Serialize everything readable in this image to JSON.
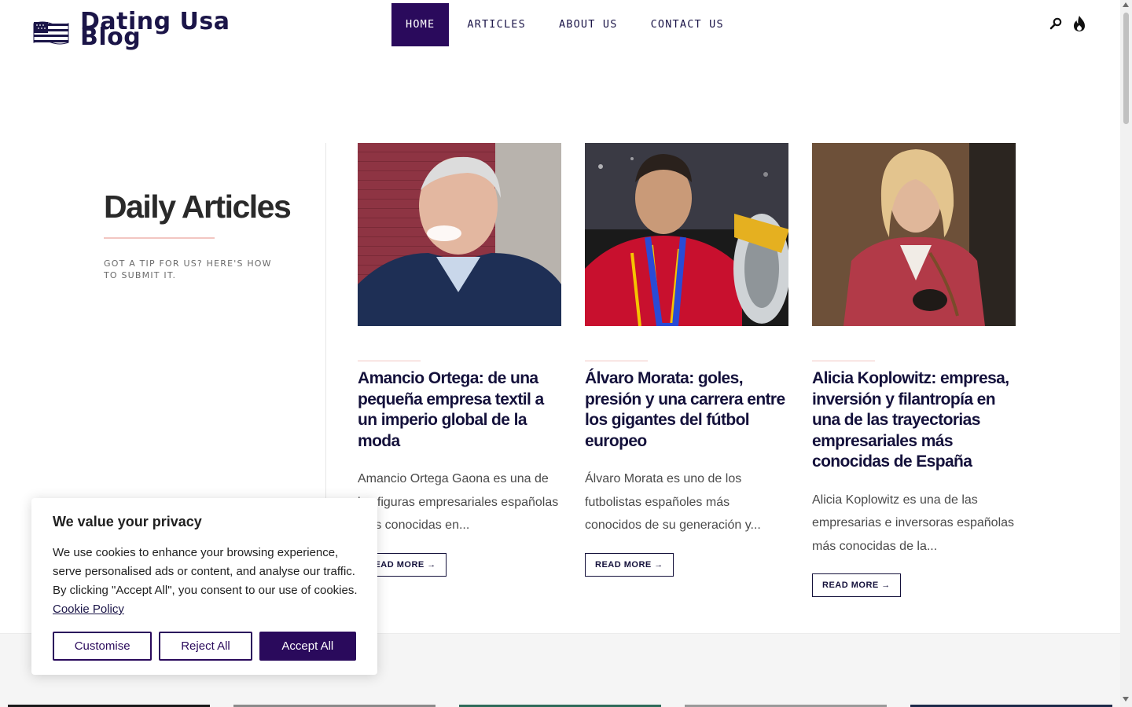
{
  "brand": {
    "name_line1": "Dating Usa",
    "name_line2": "Blog"
  },
  "nav": [
    {
      "label": "HOME",
      "active": true
    },
    {
      "label": "ARTICLES",
      "active": false
    },
    {
      "label": "ABOUT US",
      "active": false
    },
    {
      "label": "CONTACT US",
      "active": false
    }
  ],
  "header_icons": [
    "search-icon",
    "flame-icon"
  ],
  "intro": {
    "title": "Daily Articles",
    "subtitle": "GOT A TIP FOR US? HERE'S HOW TO SUBMIT IT."
  },
  "articles": [
    {
      "title": "Amancio Ortega: de una pequeña empresa textil a un imperio global de la moda",
      "excerpt": "Amancio Ortega Gaona es una de las figuras empresariales españolas más conocidas en...",
      "cta": "READ MORE →"
    },
    {
      "title": "Álvaro Morata: goles, presión y una carrera entre los gigantes del fútbol europeo",
      "excerpt": "Álvaro Morata es uno de los futbolistas españoles más conocidos de su generación y...",
      "cta": "READ MORE →"
    },
    {
      "title": "Alicia Koplowitz: empresa, inversión y filantropía en una de las trayectorias empresariales más conocidas de España",
      "excerpt": "Alicia Koplowitz es una de las empresarias e inversoras españolas más conocidas de la...",
      "cta": "READ MORE →"
    }
  ],
  "cookie": {
    "title": "We value your privacy",
    "text": "We use cookies to enhance your browsing experience, serve personalised ads or content, and analyse our traffic. By clicking \"Accept All\", you consent to our use of cookies.",
    "link": "Cookie Policy",
    "customise": "Customise",
    "reject": "Reject All",
    "accept": "Accept All"
  },
  "colors": {
    "brand": "#2a0a5c",
    "text": "#14113b",
    "accent_rule": "#f2c6c2"
  }
}
